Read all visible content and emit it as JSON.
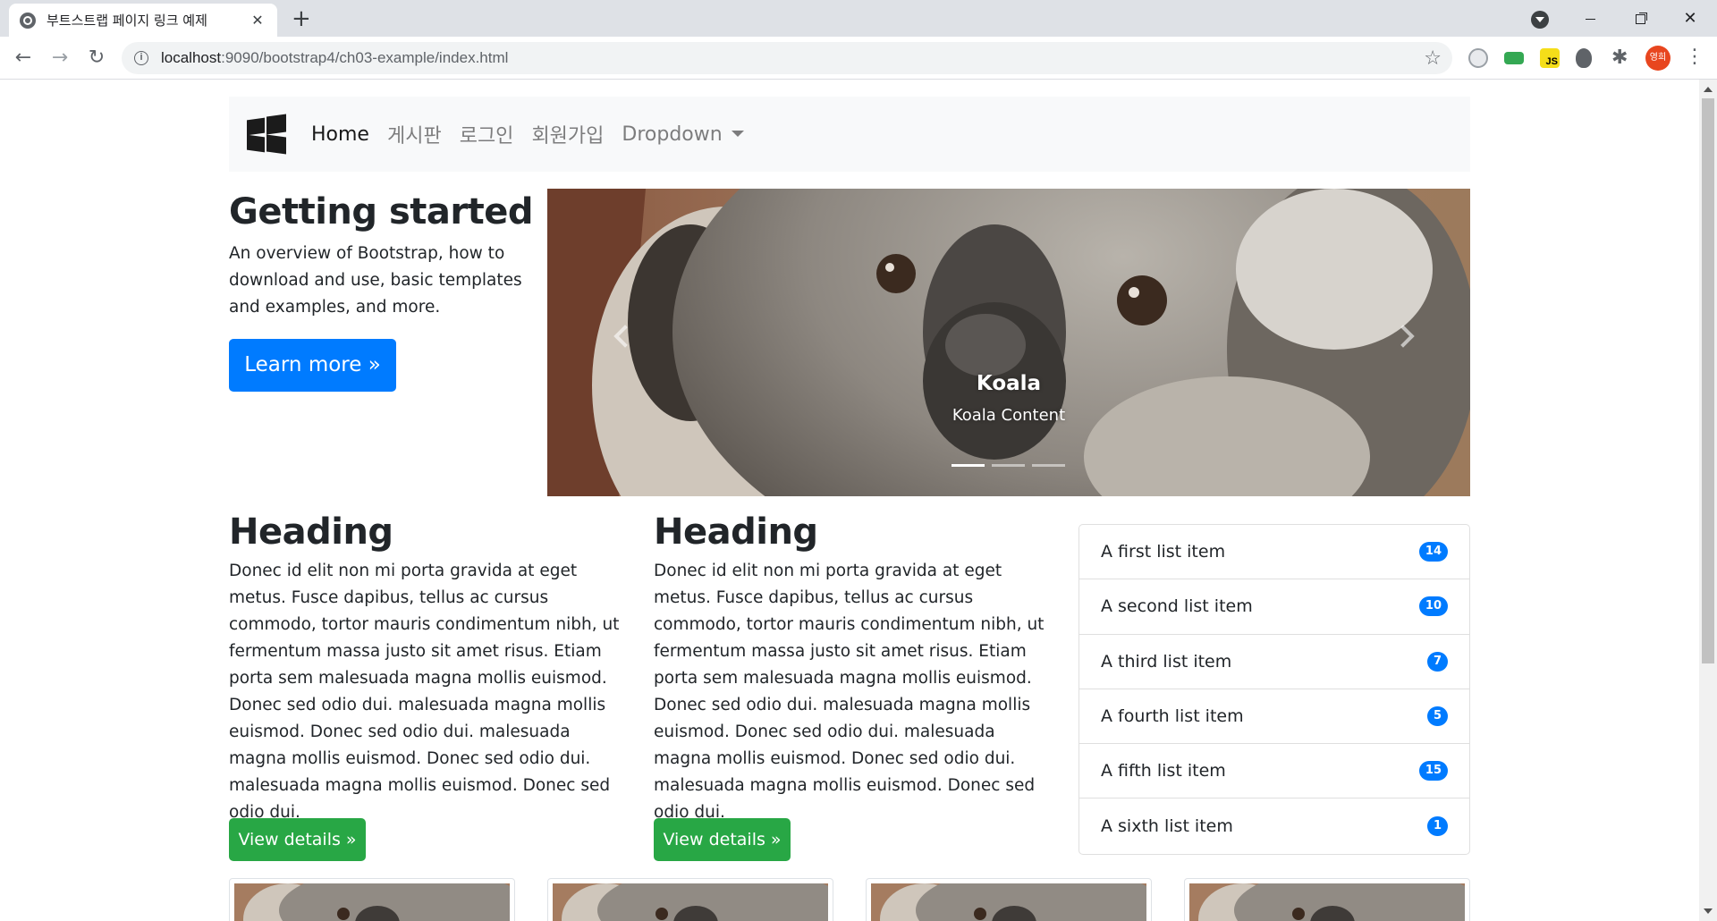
{
  "browser": {
    "tab_title": "부트스트랩 페이지 링크 예제",
    "tab_close": "✕",
    "new_tab": "+",
    "url_host": "localhost",
    "url_path": ":9090/bootstrap4/ch03-example/index.html",
    "profile_label": "영희",
    "icons": [
      "globe-icon",
      "back-icon",
      "forward-icon",
      "reload-icon",
      "info-icon",
      "star-icon",
      "extensions-icon",
      "menu-icon"
    ]
  },
  "navbar": {
    "items": [
      {
        "label": "Home",
        "active": true
      },
      {
        "label": "게시판",
        "active": false
      },
      {
        "label": "로그인",
        "active": false
      },
      {
        "label": "회원가입",
        "active": false
      },
      {
        "label": "Dropdown",
        "active": false
      }
    ]
  },
  "jumbotron": {
    "title": "Getting started",
    "text": "An overview of Bootstrap, how to download and use, basic templates and examples, and more.",
    "button": "Learn more »"
  },
  "carousel": {
    "caption_title": "Koala",
    "caption_text": "Koala Content",
    "slide_count": 3,
    "active_slide": 1
  },
  "columns": [
    {
      "heading": "Heading",
      "text": "Donec id elit non mi porta gravida at eget metus. Fusce dapibus, tellus ac cursus commodo, tortor mauris condimentum nibh, ut fermentum massa justo sit amet risus. Etiam porta sem malesuada magna mollis euismod. Donec sed odio dui. malesuada magna mollis euismod. Donec sed odio dui. malesuada magna mollis euismod. Donec sed odio dui. malesuada magna mollis euismod. Donec sed odio dui.",
      "button": "View details »"
    },
    {
      "heading": "Heading",
      "text": "Donec id elit non mi porta gravida at eget metus. Fusce dapibus, tellus ac cursus commodo, tortor mauris condimentum nibh, ut fermentum massa justo sit amet risus. Etiam porta sem malesuada magna mollis euismod. Donec sed odio dui. malesuada magna mollis euismod. Donec sed odio dui. malesuada magna mollis euismod. Donec sed odio dui. malesuada magna mollis euismod. Donec sed odio dui.",
      "button": "View details »"
    }
  ],
  "list_group": [
    {
      "label": "A first list item",
      "badge": "14"
    },
    {
      "label": "A second list item",
      "badge": "10"
    },
    {
      "label": "A third list item",
      "badge": "7"
    },
    {
      "label": "A fourth list item",
      "badge": "5"
    },
    {
      "label": "A fifth list item",
      "badge": "15"
    },
    {
      "label": "A sixth list item",
      "badge": "1"
    }
  ],
  "colors": {
    "primary": "#007bff",
    "success": "#28a745",
    "navbar_bg": "#f8f9fa"
  }
}
